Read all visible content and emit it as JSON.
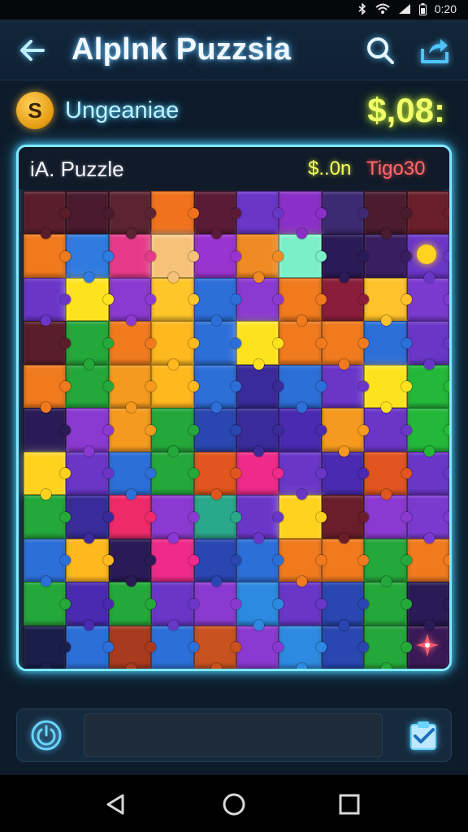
{
  "status_bar": {
    "time": "0:20"
  },
  "header": {
    "title": "Alplnk Puzzsia"
  },
  "info_row": {
    "coin_symbol": "S",
    "player_name": "Ungeaniae",
    "score": "$,08:"
  },
  "board": {
    "label": "iA. Puzzle",
    "money": "$..0n",
    "timer": "Tigo30",
    "rows": [
      [
        "#5a1e2a",
        "#4a1a2e",
        "#5c2432",
        "#f0721c",
        "#5b1b36",
        "#6a36c8",
        "#8a30c8",
        "#3e2a72",
        "#4a1c2e",
        "#6a1f2a"
      ],
      [
        "#f07a1e",
        "#2f7be0",
        "#e63a8a",
        "#f6c27a",
        "#9a34d0",
        "#f08a22",
        "#7bf0c8",
        "#2a1a56",
        "#3a1e62",
        "#6a36c8"
      ],
      [
        "#6a36c8",
        "#ffe21e",
        "#8a3ad0",
        "#ffc62a",
        "#2d6fd8",
        "#8a3ad0",
        "#f07a1e",
        "#8a1e3a",
        "#ffc22a",
        "#7a3ad0"
      ],
      [
        "#5a1e2a",
        "#24a83a",
        "#f07a1e",
        "#ffb81e",
        "#2d6fd8",
        "#ffe21e",
        "#f07a1e",
        "#f07a1e",
        "#2d6fd8",
        "#6a36c8"
      ],
      [
        "#f07a1e",
        "#24a83a",
        "#f59a1e",
        "#ffb81e",
        "#2d6fd8",
        "#3a2a9a",
        "#2d6fd8",
        "#6a36c8",
        "#ffe21e",
        "#24b83a"
      ],
      [
        "#2a1a56",
        "#8a3ad0",
        "#f59a1e",
        "#24a83a",
        "#2a46b0",
        "#3a2a9a",
        "#4a2ab0",
        "#f59a1e",
        "#6a36c8",
        "#24b83a"
      ],
      [
        "#ffd21e",
        "#6a36c8",
        "#2d6fd8",
        "#24a83a",
        "#e0561e",
        "#ef2a8a",
        "#6a36c8",
        "#4a2ab0",
        "#e0561e",
        "#6a36c8"
      ],
      [
        "#24a83a",
        "#3a2a9a",
        "#ef2a6a",
        "#8a3ad0",
        "#2aa88a",
        "#6a36c8",
        "#ffd21e",
        "#6a1e2a",
        "#8a3ad0",
        "#7a3ad0"
      ],
      [
        "#2d6fd8",
        "#ffb81e",
        "#2a1a56",
        "#ef2a8a",
        "#2a46b0",
        "#2d6fd8",
        "#f07a1e",
        "#f07a1e",
        "#24a83a",
        "#f07a1e"
      ],
      [
        "#24a83a",
        "#4a2ab0",
        "#24a83a",
        "#6a36c8",
        "#8a3ad0",
        "#2d8ae0",
        "#6a36c8",
        "#2a46b0",
        "#24a83a",
        "#2a1a56"
      ],
      [
        "#1a1e4a",
        "#2d6fd8",
        "#a83a1e",
        "#2d6fd8",
        "#c8521e",
        "#8a3ad0",
        "#2d8ae0",
        "#2a46b0",
        "#24a83a",
        "#3a1a56"
      ]
    ]
  },
  "bottom_bar": {
    "message_value": ""
  },
  "colors": {
    "accent": "#7fe8ff",
    "score": "#f0ff6a",
    "timer": "#ff6a6a"
  },
  "icons": {
    "back": "back-arrow-icon",
    "search": "search-icon",
    "share": "share-icon",
    "coin": "coin-icon",
    "power": "power-icon",
    "clipboard": "clipboard-check-icon",
    "nav_back": "triangle-back-icon",
    "nav_home": "circle-home-icon",
    "nav_recent": "square-recents-icon"
  }
}
